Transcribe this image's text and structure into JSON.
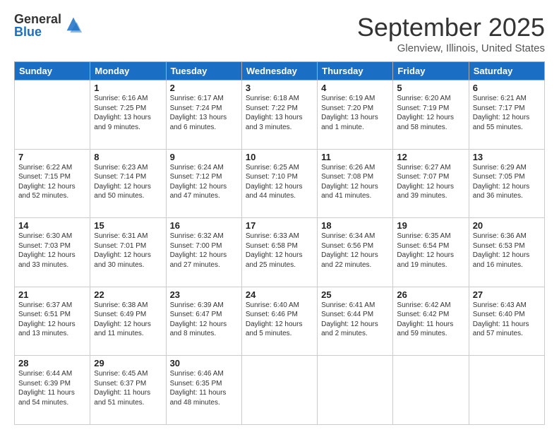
{
  "logo": {
    "general": "General",
    "blue": "Blue"
  },
  "title": "September 2025",
  "location": "Glenview, Illinois, United States",
  "weekdays": [
    "Sunday",
    "Monday",
    "Tuesday",
    "Wednesday",
    "Thursday",
    "Friday",
    "Saturday"
  ],
  "weeks": [
    [
      {
        "day": "",
        "info": ""
      },
      {
        "day": "1",
        "info": "Sunrise: 6:16 AM\nSunset: 7:25 PM\nDaylight: 13 hours\nand 9 minutes."
      },
      {
        "day": "2",
        "info": "Sunrise: 6:17 AM\nSunset: 7:24 PM\nDaylight: 13 hours\nand 6 minutes."
      },
      {
        "day": "3",
        "info": "Sunrise: 6:18 AM\nSunset: 7:22 PM\nDaylight: 13 hours\nand 3 minutes."
      },
      {
        "day": "4",
        "info": "Sunrise: 6:19 AM\nSunset: 7:20 PM\nDaylight: 13 hours\nand 1 minute."
      },
      {
        "day": "5",
        "info": "Sunrise: 6:20 AM\nSunset: 7:19 PM\nDaylight: 12 hours\nand 58 minutes."
      },
      {
        "day": "6",
        "info": "Sunrise: 6:21 AM\nSunset: 7:17 PM\nDaylight: 12 hours\nand 55 minutes."
      }
    ],
    [
      {
        "day": "7",
        "info": "Sunrise: 6:22 AM\nSunset: 7:15 PM\nDaylight: 12 hours\nand 52 minutes."
      },
      {
        "day": "8",
        "info": "Sunrise: 6:23 AM\nSunset: 7:14 PM\nDaylight: 12 hours\nand 50 minutes."
      },
      {
        "day": "9",
        "info": "Sunrise: 6:24 AM\nSunset: 7:12 PM\nDaylight: 12 hours\nand 47 minutes."
      },
      {
        "day": "10",
        "info": "Sunrise: 6:25 AM\nSunset: 7:10 PM\nDaylight: 12 hours\nand 44 minutes."
      },
      {
        "day": "11",
        "info": "Sunrise: 6:26 AM\nSunset: 7:08 PM\nDaylight: 12 hours\nand 41 minutes."
      },
      {
        "day": "12",
        "info": "Sunrise: 6:27 AM\nSunset: 7:07 PM\nDaylight: 12 hours\nand 39 minutes."
      },
      {
        "day": "13",
        "info": "Sunrise: 6:29 AM\nSunset: 7:05 PM\nDaylight: 12 hours\nand 36 minutes."
      }
    ],
    [
      {
        "day": "14",
        "info": "Sunrise: 6:30 AM\nSunset: 7:03 PM\nDaylight: 12 hours\nand 33 minutes."
      },
      {
        "day": "15",
        "info": "Sunrise: 6:31 AM\nSunset: 7:01 PM\nDaylight: 12 hours\nand 30 minutes."
      },
      {
        "day": "16",
        "info": "Sunrise: 6:32 AM\nSunset: 7:00 PM\nDaylight: 12 hours\nand 27 minutes."
      },
      {
        "day": "17",
        "info": "Sunrise: 6:33 AM\nSunset: 6:58 PM\nDaylight: 12 hours\nand 25 minutes."
      },
      {
        "day": "18",
        "info": "Sunrise: 6:34 AM\nSunset: 6:56 PM\nDaylight: 12 hours\nand 22 minutes."
      },
      {
        "day": "19",
        "info": "Sunrise: 6:35 AM\nSunset: 6:54 PM\nDaylight: 12 hours\nand 19 minutes."
      },
      {
        "day": "20",
        "info": "Sunrise: 6:36 AM\nSunset: 6:53 PM\nDaylight: 12 hours\nand 16 minutes."
      }
    ],
    [
      {
        "day": "21",
        "info": "Sunrise: 6:37 AM\nSunset: 6:51 PM\nDaylight: 12 hours\nand 13 minutes."
      },
      {
        "day": "22",
        "info": "Sunrise: 6:38 AM\nSunset: 6:49 PM\nDaylight: 12 hours\nand 11 minutes."
      },
      {
        "day": "23",
        "info": "Sunrise: 6:39 AM\nSunset: 6:47 PM\nDaylight: 12 hours\nand 8 minutes."
      },
      {
        "day": "24",
        "info": "Sunrise: 6:40 AM\nSunset: 6:46 PM\nDaylight: 12 hours\nand 5 minutes."
      },
      {
        "day": "25",
        "info": "Sunrise: 6:41 AM\nSunset: 6:44 PM\nDaylight: 12 hours\nand 2 minutes."
      },
      {
        "day": "26",
        "info": "Sunrise: 6:42 AM\nSunset: 6:42 PM\nDaylight: 11 hours\nand 59 minutes."
      },
      {
        "day": "27",
        "info": "Sunrise: 6:43 AM\nSunset: 6:40 PM\nDaylight: 11 hours\nand 57 minutes."
      }
    ],
    [
      {
        "day": "28",
        "info": "Sunrise: 6:44 AM\nSunset: 6:39 PM\nDaylight: 11 hours\nand 54 minutes."
      },
      {
        "day": "29",
        "info": "Sunrise: 6:45 AM\nSunset: 6:37 PM\nDaylight: 11 hours\nand 51 minutes."
      },
      {
        "day": "30",
        "info": "Sunrise: 6:46 AM\nSunset: 6:35 PM\nDaylight: 11 hours\nand 48 minutes."
      },
      {
        "day": "",
        "info": ""
      },
      {
        "day": "",
        "info": ""
      },
      {
        "day": "",
        "info": ""
      },
      {
        "day": "",
        "info": ""
      }
    ]
  ]
}
